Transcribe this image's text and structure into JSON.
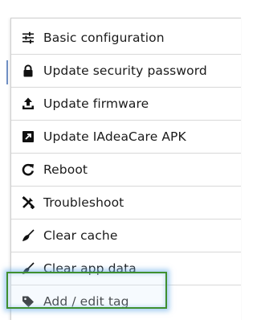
{
  "menu": {
    "items": [
      {
        "label": "Basic configuration",
        "icon": "sliders-icon"
      },
      {
        "label": "Update security password",
        "icon": "lock-icon"
      },
      {
        "label": "Update firmware",
        "icon": "upload-icon"
      },
      {
        "label": "Update IAdeaCare APK",
        "icon": "external-link-icon"
      },
      {
        "label": "Reboot",
        "icon": "refresh-icon"
      },
      {
        "label": "Troubleshoot",
        "icon": "tools-icon"
      },
      {
        "label": "Clear cache",
        "icon": "broom-icon"
      },
      {
        "label": "Clear app data",
        "icon": "broom-icon"
      },
      {
        "label": "Add / edit tag",
        "icon": "tag-icon"
      }
    ],
    "highlighted_item": "Add / edit tag",
    "highlight_color": "#3f8f2f"
  }
}
